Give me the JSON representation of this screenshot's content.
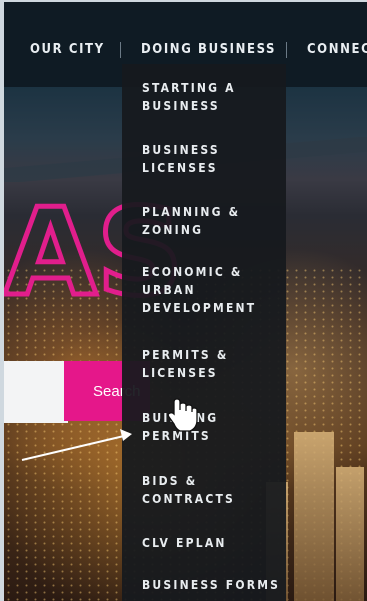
{
  "topnav": {
    "items": [
      {
        "label": "OUR CITY"
      },
      {
        "label": "DOING BUSINESS"
      },
      {
        "label": "CONNECT"
      }
    ]
  },
  "hero": {
    "search": {
      "placeholder": "",
      "button_label": "Search"
    }
  },
  "dropdown": {
    "items": [
      {
        "label": "STARTING A\nBUSINESS"
      },
      {
        "label": "BUSINESS\nLICENSES"
      },
      {
        "label": "PLANNING &\nZONING"
      },
      {
        "label": "ECONOMIC &\nURBAN\nDEVELOPMENT"
      },
      {
        "label": "PERMITS &\nLICENSES"
      },
      {
        "label": "BUILDING\nPERMITS"
      },
      {
        "label": "BIDS &\nCONTRACTS"
      },
      {
        "label": "CLV EPLAN"
      },
      {
        "label": "BUSINESS FORMS"
      }
    ]
  },
  "colors": {
    "brand_pink": "#e5178a",
    "nav_bg": "#0f1b24",
    "dropdown_bg": "#16191e"
  },
  "icons": {
    "cursor": "hand-pointer-icon",
    "annotation": "arrow-icon"
  }
}
